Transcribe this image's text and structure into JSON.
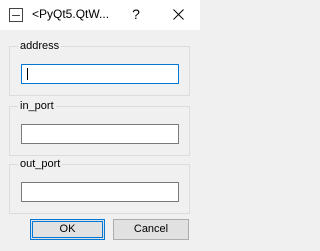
{
  "window": {
    "title": "<PyQt5.QtW...",
    "help_glyph": "?",
    "close_icon": "close-icon"
  },
  "fields": [
    {
      "label": "address",
      "value": "",
      "focused": true
    },
    {
      "label": "in_port",
      "value": "",
      "focused": false
    },
    {
      "label": "out_port",
      "value": "",
      "focused": false
    }
  ],
  "buttons": {
    "ok_label": "OK",
    "cancel_label": "Cancel"
  },
  "colors": {
    "focus": "#0078d7",
    "background": "#f0f0f0"
  }
}
